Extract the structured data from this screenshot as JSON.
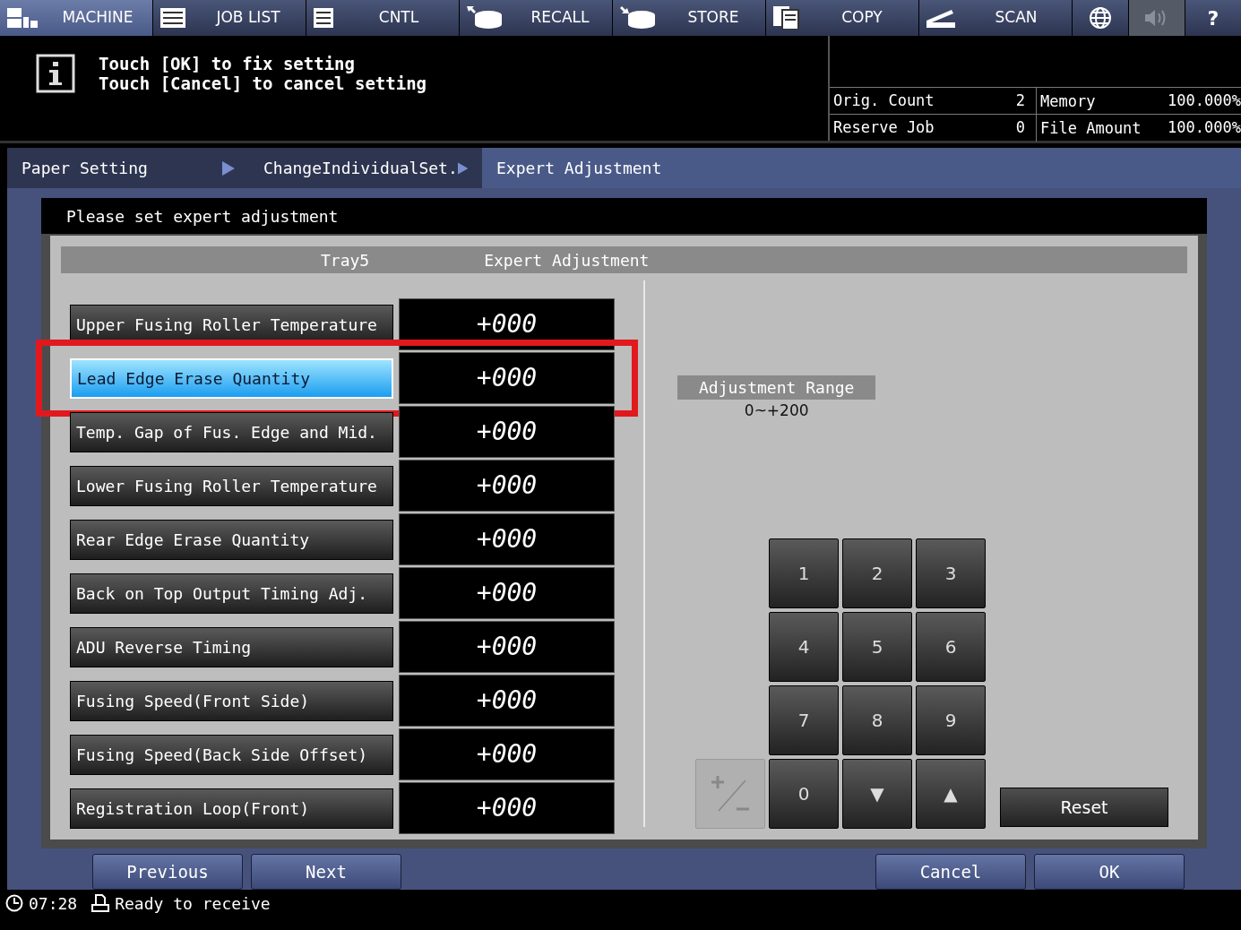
{
  "top_tabs": [
    {
      "label": "MACHINE",
      "kind": "machine",
      "selected": true
    },
    {
      "label": "JOB LIST",
      "kind": "list",
      "selected": false
    },
    {
      "label": "CNTL",
      "kind": "cntl",
      "selected": false
    },
    {
      "label": "RECALL",
      "kind": "recall",
      "selected": false
    },
    {
      "label": "STORE",
      "kind": "store",
      "selected": false
    },
    {
      "label": "COPY",
      "kind": "copy",
      "selected": false
    },
    {
      "label": "SCAN",
      "kind": "scan",
      "selected": false
    }
  ],
  "tool_buttons": [
    {
      "kind": "globe",
      "disabled": false
    },
    {
      "kind": "speaker",
      "disabled": true
    },
    {
      "kind": "help",
      "label": "?",
      "disabled": false
    }
  ],
  "message": {
    "lines": [
      "Touch [OK] to fix setting",
      "Touch [Cancel] to cancel setting"
    ]
  },
  "counters": [
    {
      "label": "Orig. Count",
      "value": "2",
      "memory_label": "Memory",
      "memory_value": "100.000%"
    },
    {
      "label": "Reserve Job",
      "value": "0",
      "memory_label": "File Amount",
      "memory_value": "100.000%"
    }
  ],
  "breadcrumb": [
    {
      "label": "Paper Setting",
      "selected": false
    },
    {
      "label": "ChangeIndividualSet.",
      "selected": false
    },
    {
      "label": "Expert Adjustment",
      "selected": true
    }
  ],
  "instruction": "Please set expert adjustment",
  "panel": {
    "tray": "Tray5",
    "title": "Expert Adjustment"
  },
  "items": [
    {
      "label": "Upper Fusing Roller Temperature",
      "value": "+000",
      "selected": false
    },
    {
      "label": "Lead Edge Erase Quantity",
      "value": "+000",
      "selected": true
    },
    {
      "label": "Temp. Gap of Fus. Edge and Mid.",
      "value": "+000",
      "selected": false
    },
    {
      "label": "Lower Fusing Roller Temperature",
      "value": "+000",
      "selected": false
    },
    {
      "label": "Rear Edge Erase Quantity",
      "value": "+000",
      "selected": false
    },
    {
      "label": "Back on Top Output Timing Adj.",
      "value": "+000",
      "selected": false
    },
    {
      "label": "ADU Reverse Timing",
      "value": "+000",
      "selected": false
    },
    {
      "label": "Fusing Speed(Front Side)",
      "value": "+000",
      "selected": false
    },
    {
      "label": "Fusing Speed(Back Side Offset)",
      "value": "+000",
      "selected": false
    },
    {
      "label": "Registration Loop(Front)",
      "value": "+000",
      "selected": false
    }
  ],
  "range": {
    "label": "Adjustment Range",
    "value": "0~+200"
  },
  "keypad": [
    {
      "kind": "key",
      "label": "1"
    },
    {
      "kind": "key",
      "label": "2"
    },
    {
      "kind": "key",
      "label": "3"
    },
    {
      "kind": "key",
      "label": "4"
    },
    {
      "kind": "key",
      "label": "5"
    },
    {
      "kind": "key",
      "label": "6"
    },
    {
      "kind": "key",
      "label": "7"
    },
    {
      "kind": "key",
      "label": "8"
    },
    {
      "kind": "key",
      "label": "9"
    },
    {
      "kind": "sign",
      "disabled": true
    },
    {
      "kind": "key",
      "label": "0"
    },
    {
      "kind": "key",
      "label": "▼"
    },
    {
      "kind": "key",
      "label": "▲"
    }
  ],
  "reset_button": "Reset",
  "nav_buttons_left": [
    "Previous",
    "Next"
  ],
  "nav_buttons_right": [
    "Cancel",
    "OK"
  ],
  "status_bar": {
    "time": "07:28",
    "text": "Ready to receive"
  }
}
